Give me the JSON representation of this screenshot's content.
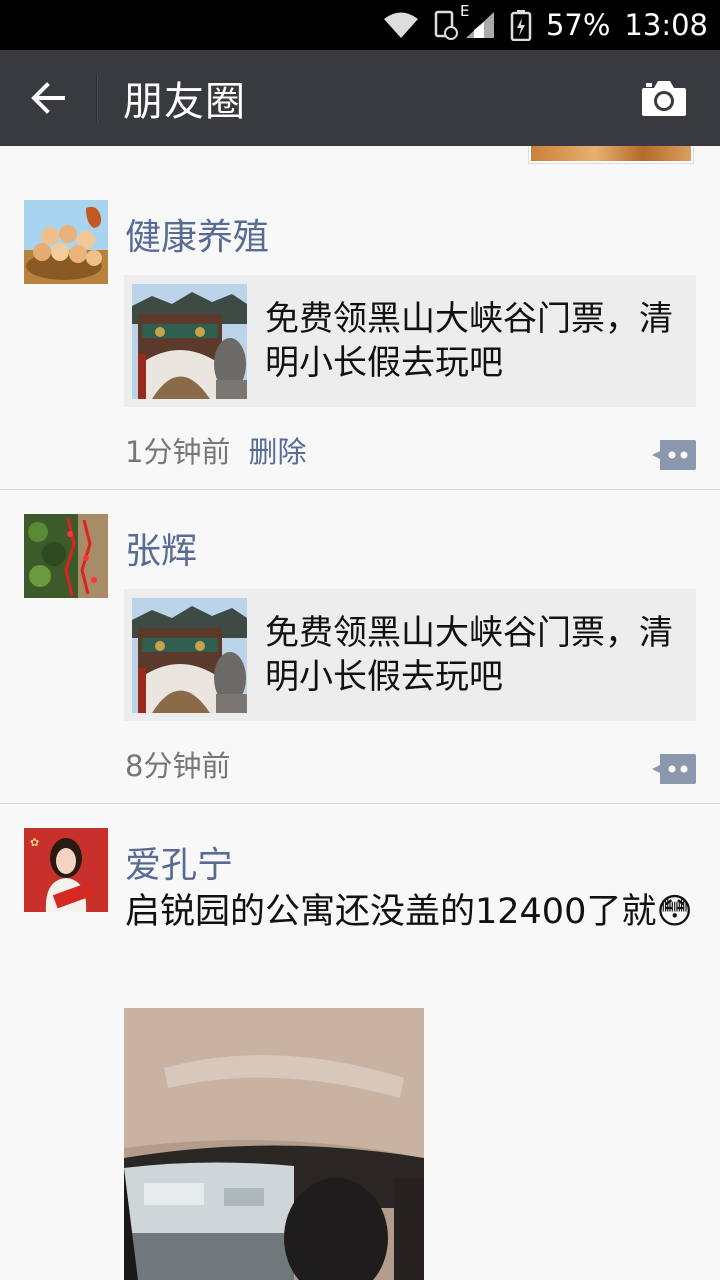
{
  "status_bar": {
    "network_type": "E",
    "sim_slot": "1",
    "battery_percent": "57%",
    "time": "13:08",
    "icons": [
      "wifi-icon",
      "sim-icon",
      "signal-icon",
      "battery-icon"
    ]
  },
  "title_bar": {
    "back_icon": "arrow-left-icon",
    "title": "朋友圈",
    "camera_icon": "camera-icon"
  },
  "posts": [
    {
      "name": "健康养殖",
      "link_text": "免费领黑山大峡谷门票，清明小长假去玩吧",
      "time": "1分钟前",
      "delete_label": "删除"
    },
    {
      "name": "张辉",
      "link_text": "免费领黑山大峡谷门票，清明小长假去玩吧",
      "time": "8分钟前"
    },
    {
      "name": "爱孔宁",
      "text": "启锐园的公寓还没盖的12400了就",
      "emoji": "😳"
    }
  ],
  "colors": {
    "title_bar_bg": "#393a3f",
    "name_color": "#576b95",
    "feed_bg": "#f8f8f8",
    "card_bg": "#ededed"
  }
}
